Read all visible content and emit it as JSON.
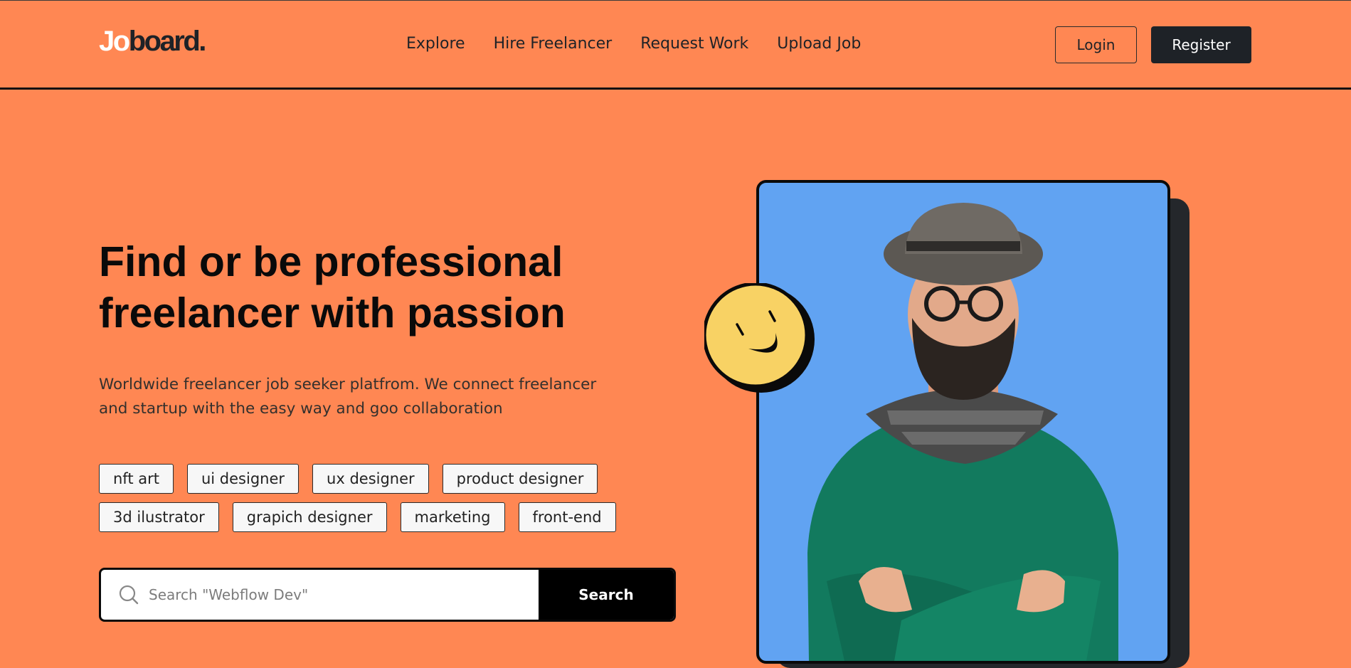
{
  "brand": {
    "logo_jo": "Jo",
    "logo_rest": "board."
  },
  "nav": {
    "items": [
      "Explore",
      "Hire Freelancer",
      "Request Work",
      "Upload Job"
    ]
  },
  "auth": {
    "login_label": "Login",
    "register_label": "Register"
  },
  "hero": {
    "title_line1": "Find or be professional",
    "title_line2": "freelancer with passion",
    "subtitle_line1": "Worldwide freelancer job seeker platfrom. We connect freelancer",
    "subtitle_line2": "and startup with the easy way and goo collaboration"
  },
  "tags": {
    "row1": [
      "nft art",
      "ui designer",
      "ux designer",
      "product designer"
    ],
    "row2": [
      "3d ilustrator",
      "grapich designer",
      "marketing",
      "front-end"
    ]
  },
  "search": {
    "placeholder": "Search \"Webflow Dev\"",
    "button_label": "Search",
    "icon": "search-icon"
  },
  "colors": {
    "background": "#FF8753",
    "dark": "#1E2227",
    "card_blue": "#61A3F2",
    "smiley_yellow": "#F8D264",
    "sweater_green": "#127A5E"
  }
}
